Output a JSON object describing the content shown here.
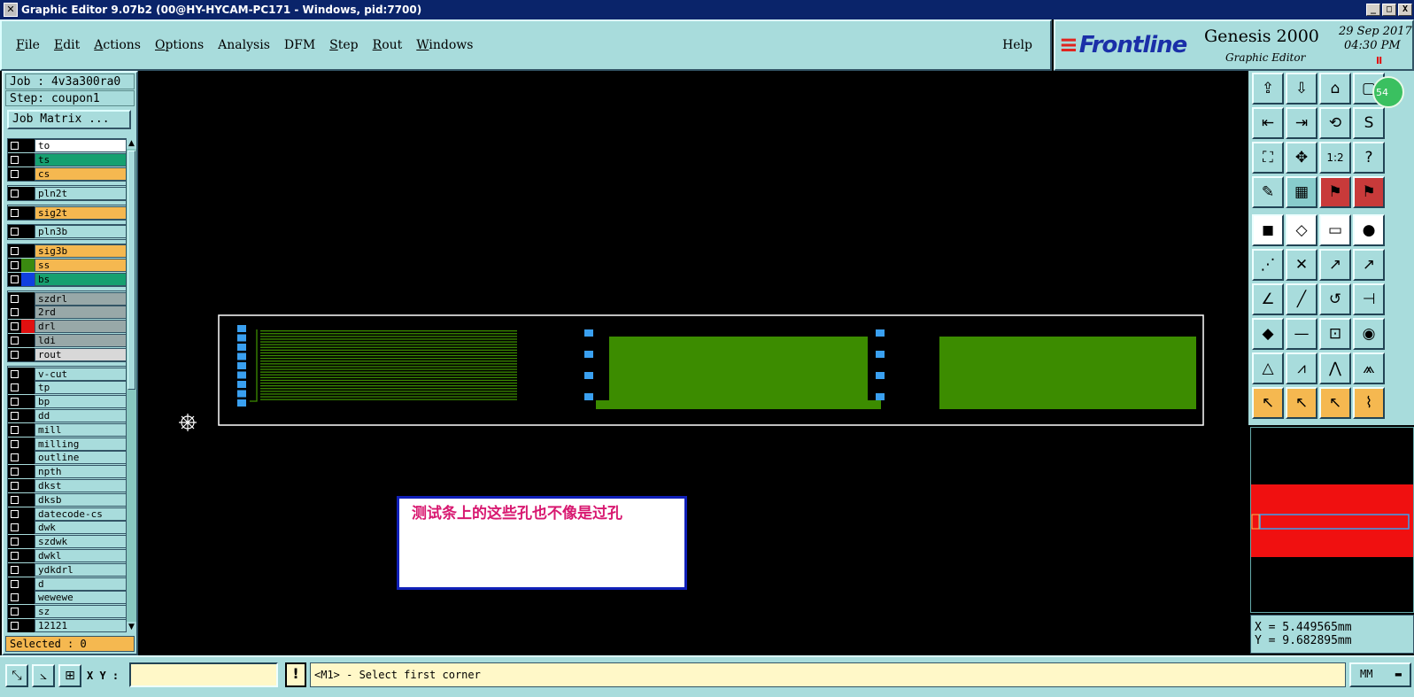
{
  "window": {
    "title": "Graphic Editor 9.07b2 (00@HY-HYCAM-PC171 - Windows, pid:7700)",
    "controls": [
      "_",
      "□",
      "X"
    ]
  },
  "menu": {
    "items": [
      {
        "pre": "",
        "u": "F",
        "post": "ile"
      },
      {
        "pre": "",
        "u": "E",
        "post": "dit"
      },
      {
        "pre": "",
        "u": "A",
        "post": "ctions"
      },
      {
        "pre": "",
        "u": "O",
        "post": "ptions"
      },
      {
        "pre": "Analysis",
        "u": "",
        "post": ""
      },
      {
        "pre": "DFM",
        "u": "",
        "post": ""
      },
      {
        "pre": "",
        "u": "S",
        "post": "tep"
      },
      {
        "pre": "",
        "u": "R",
        "post": "out"
      },
      {
        "pre": "",
        "u": "W",
        "post": "indows"
      }
    ],
    "help": "Help"
  },
  "logo": {
    "brand": "Frontline",
    "product": "Genesis 2000",
    "subtitle": "Graphic Editor",
    "date": "29  Sep  2017",
    "time": "04:30  PM",
    "pause": "II"
  },
  "left": {
    "job": "Job : 4v3a300ra0",
    "step": "Step: coupon1",
    "job_matrix": "Job Matrix ...",
    "selected": "Selected : 0",
    "groups": [
      [
        {
          "name": "to",
          "bg": "#ffffff",
          "swatch": "#000000"
        },
        {
          "name": "ts",
          "bg": "#16a070",
          "swatch": "#000000"
        },
        {
          "name": "cs",
          "bg": "#f5b850",
          "swatch": "#000000"
        }
      ],
      [
        {
          "name": "pln2t",
          "bg": "#a8dcdc",
          "swatch": "#000000"
        }
      ],
      [
        {
          "name": "sig2t",
          "bg": "#f5b850",
          "swatch": "#000000"
        }
      ],
      [
        {
          "name": "pln3b",
          "bg": "#a8dcdc",
          "swatch": "#000000"
        }
      ],
      [
        {
          "name": "sig3b",
          "bg": "#f5b850",
          "swatch": "#000000"
        },
        {
          "name": "ss",
          "bg": "#f5b850",
          "swatch": "#3a8a10"
        },
        {
          "name": "bs",
          "bg": "#16a070",
          "swatch": "#1040e0"
        }
      ],
      [
        {
          "name": "szdrl",
          "bg": "#98a8a8",
          "swatch": "#000000"
        },
        {
          "name": "2rd",
          "bg": "#98a8a8",
          "swatch": "#000000"
        },
        {
          "name": "drl",
          "bg": "#98a8a8",
          "swatch": "#e01010"
        },
        {
          "name": "ldi",
          "bg": "#98a8a8",
          "swatch": "#000000"
        },
        {
          "name": "rout",
          "bg": "#d8d8d8",
          "swatch": "#000000"
        }
      ],
      [
        {
          "name": "v-cut",
          "bg": "#a8dcdc",
          "swatch": "#000000"
        },
        {
          "name": "tp",
          "bg": "#a8dcdc",
          "swatch": "#000000"
        },
        {
          "name": "bp",
          "bg": "#a8dcdc",
          "swatch": "#000000"
        },
        {
          "name": "dd",
          "bg": "#a8dcdc",
          "swatch": "#000000"
        },
        {
          "name": "mill",
          "bg": "#a8dcdc",
          "swatch": "#000000"
        },
        {
          "name": "milling",
          "bg": "#a8dcdc",
          "swatch": "#000000"
        },
        {
          "name": "outline",
          "bg": "#a8dcdc",
          "swatch": "#000000"
        },
        {
          "name": "npth",
          "bg": "#a8dcdc",
          "swatch": "#000000"
        },
        {
          "name": "dkst",
          "bg": "#a8dcdc",
          "swatch": "#000000"
        },
        {
          "name": "dksb",
          "bg": "#a8dcdc",
          "swatch": "#000000"
        },
        {
          "name": "datecode-cs",
          "bg": "#a8dcdc",
          "swatch": "#000000"
        },
        {
          "name": "dwk",
          "bg": "#a8dcdc",
          "swatch": "#000000"
        },
        {
          "name": "szdwk",
          "bg": "#a8dcdc",
          "swatch": "#000000"
        },
        {
          "name": "dwkl",
          "bg": "#a8dcdc",
          "swatch": "#000000"
        },
        {
          "name": "ydkdrl",
          "bg": "#a8dcdc",
          "swatch": "#000000"
        },
        {
          "name": "d",
          "bg": "#a8dcdc",
          "swatch": "#000000"
        },
        {
          "name": "wewewe",
          "bg": "#a8dcdc",
          "swatch": "#000000"
        },
        {
          "name": "sz",
          "bg": "#a8dcdc",
          "swatch": "#000000"
        },
        {
          "name": "12121",
          "bg": "#a8dcdc",
          "swatch": "#000000"
        }
      ]
    ]
  },
  "canvas": {
    "annotation": "测试条上的这些孔也不像是过孔",
    "copper_color": "#3c8c00",
    "pad_color": "#3aa0f0",
    "outline_color": "#ffffff"
  },
  "right": {
    "badge": "54",
    "x_readout": "X = 5.449565mm",
    "y_readout": "Y = 9.682895mm"
  },
  "status": {
    "xy_label": "X Y :",
    "xy_value": "",
    "warn": "!",
    "message": "<M1> - Select first corner",
    "unit": "MM"
  }
}
